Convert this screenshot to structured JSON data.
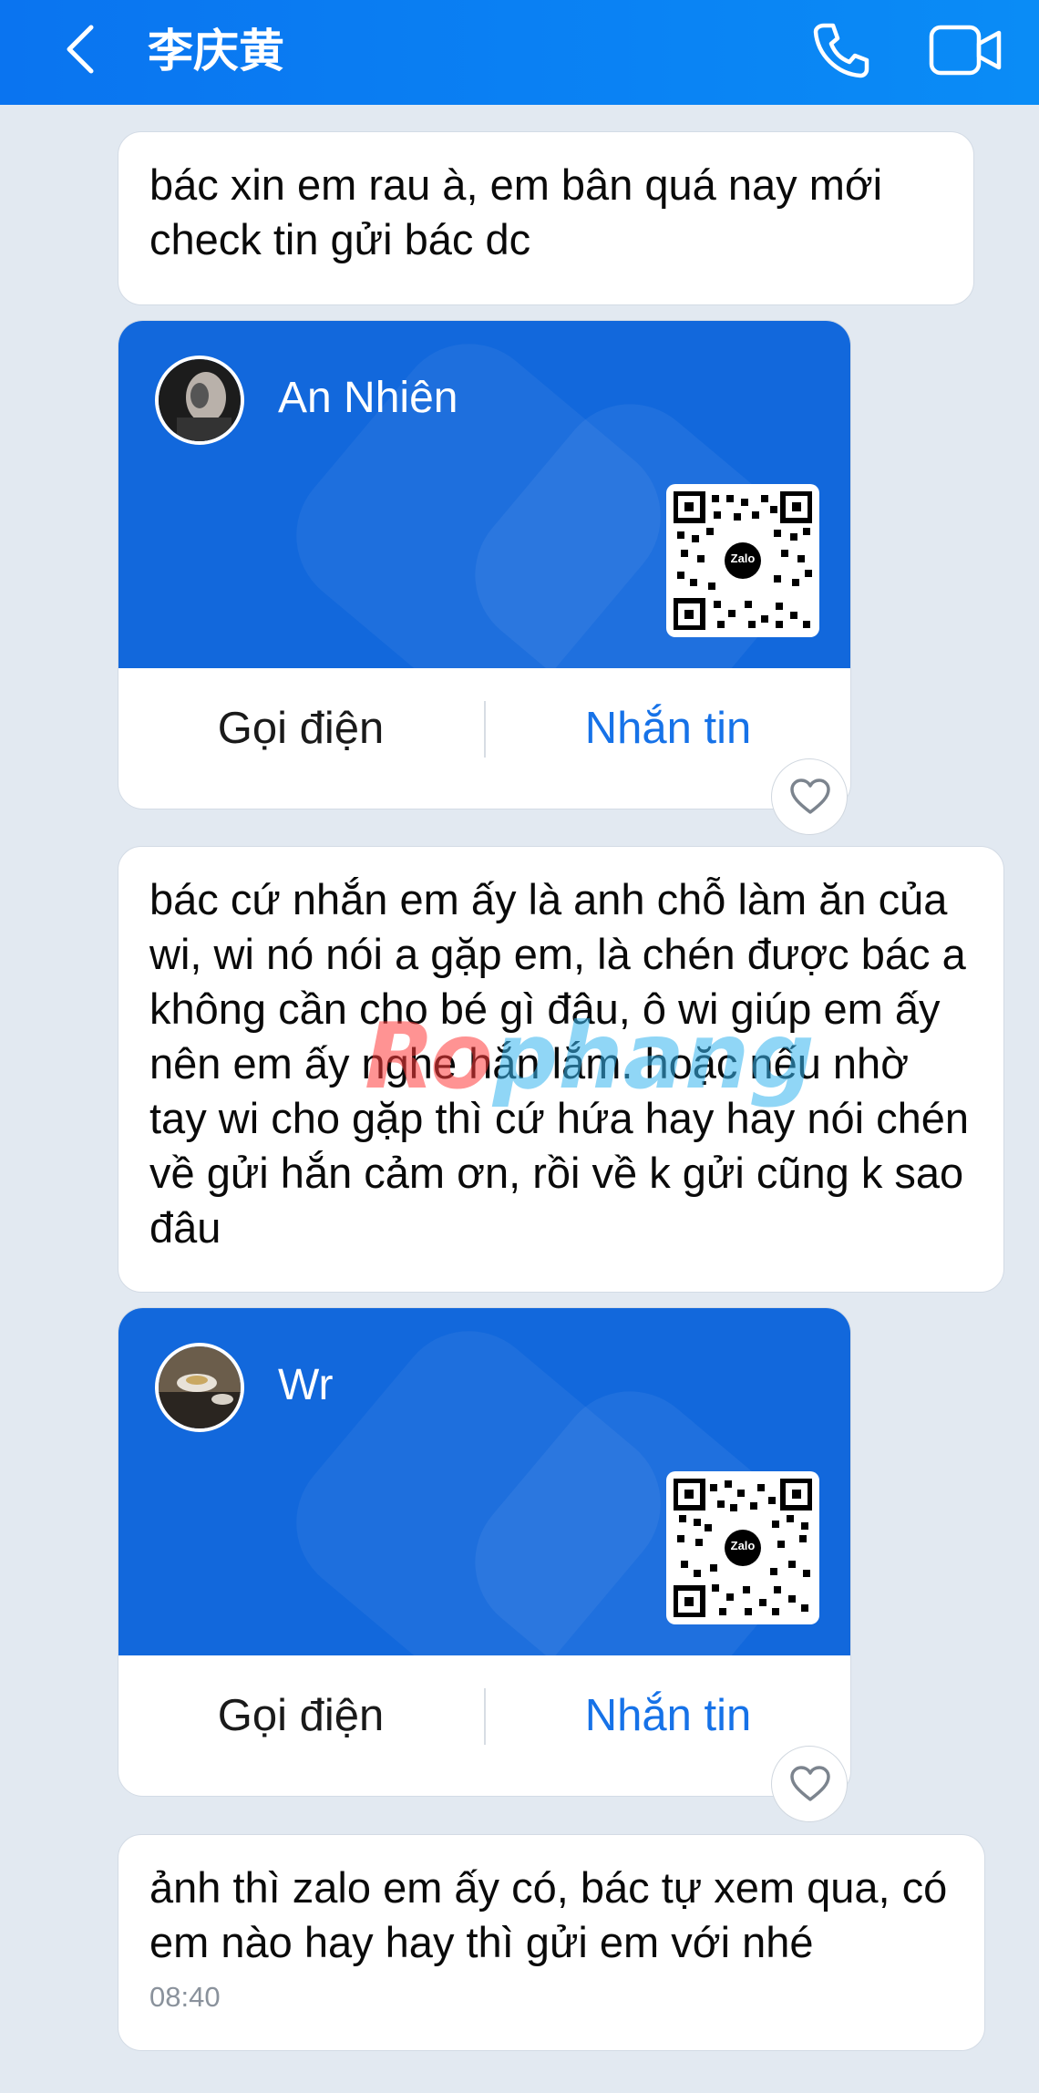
{
  "header": {
    "title": "李庆黄",
    "back_icon": "chevron-left-icon",
    "call_icon": "phone-icon",
    "video_icon": "video-camera-icon",
    "color": "#0a7df2"
  },
  "messages": [
    {
      "text": "bác xin em rau à, em bân quá nay mới check tin gửi bác dc"
    },
    {
      "text": "bác cứ nhắn em ấy là anh chỗ làm ăn của wi, wi nó nói a gặp em, là chén được bác a không cần cho bé gì đâu,  ô wi giúp em ấy nên em ấy nghe hắn lắm. hoặc nếu nhờ tay wi cho gặp thì cứ hứa hay hay nói chén về gửi hắn cảm ơn, rồi về k gửi cũng k sao đâu"
    },
    {
      "text": "ảnh thì zalo em ấy có, bác tự xem qua, có em nào hay hay thì gửi em với nhé",
      "time": "08:40"
    }
  ],
  "cards": [
    {
      "name": "An Nhiên",
      "call_label": "Gọi điện",
      "message_label": "Nhắn tin",
      "qr_label": "Zalo"
    },
    {
      "name": "Wr",
      "call_label": "Gọi điện",
      "message_label": "Nhắn tin",
      "qr_label": "Zalo"
    }
  ],
  "watermark": {
    "part1": "Ro",
    "part2": "phang"
  },
  "colors": {
    "card_bg": "#1268dc",
    "link": "#1672e8",
    "background": "#e2e9f1"
  }
}
